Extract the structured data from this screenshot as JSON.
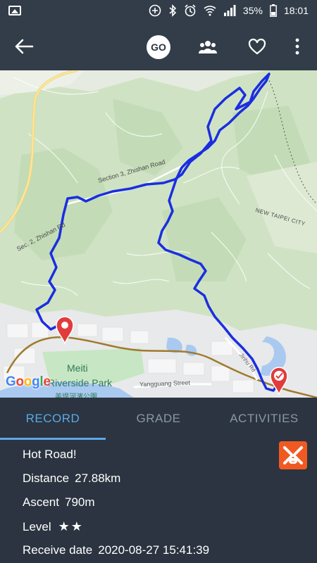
{
  "status_bar": {
    "battery_percent": "35%",
    "time": "18:01",
    "icons": [
      "picture-icon",
      "add-circle-icon",
      "bluetooth-icon",
      "alarm-icon",
      "wifi-icon",
      "signal-icon",
      "battery-icon"
    ]
  },
  "app_bar": {
    "go_label": "GO",
    "icons": [
      "back-arrow-icon",
      "go-icon",
      "group-icon",
      "heart-icon",
      "more-vertical-icon"
    ]
  },
  "map": {
    "provider": "Google",
    "road_labels": {
      "section": "Section 3, Zhishan Road",
      "zhishan": "Sec. 2, Zhishan Rd",
      "new_taipei": "NEW TAIPEI CITY",
      "yangguang": "Yangguang Street",
      "jinhu": "Jinhu Rd"
    },
    "park_name_line1": "Meiti",
    "park_name_line2": "Riverside Park",
    "park_name_line3": "美堤河濱公園",
    "route_color": "#1a2ee0",
    "markers": [
      "start-pin-icon",
      "finish-pin-icon"
    ]
  },
  "tabs": [
    {
      "label": "RECORD",
      "active": true
    },
    {
      "label": "GRADE",
      "active": false
    },
    {
      "label": "ACTIVITIES",
      "active": false
    }
  ],
  "record": {
    "name": "Hot Road!",
    "distance_label": "Distance",
    "distance_value": "27.88km",
    "ascent_label": "Ascent",
    "ascent_value": "790m",
    "level_label": "Level",
    "level_stars": "★★",
    "level_value": 2,
    "receive_label": "Receive date",
    "receive_value": "2020-08-27 15:41:39"
  },
  "colors": {
    "background": "#2b3440",
    "bar": "#323d49",
    "accent": "#5aa9e8",
    "brand": "#f05a22"
  }
}
